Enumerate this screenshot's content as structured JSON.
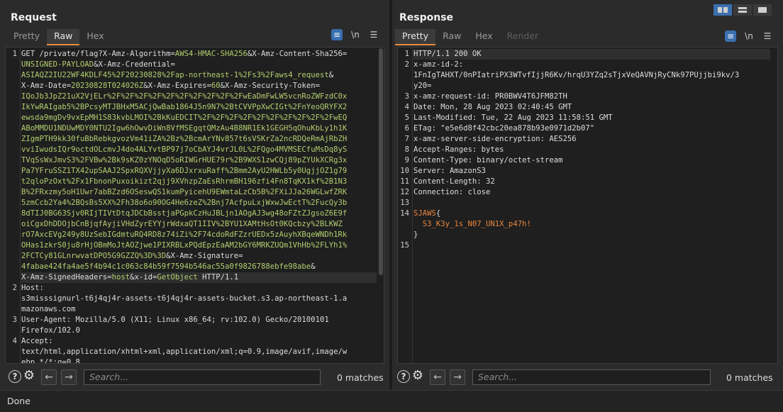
{
  "request": {
    "title": "Request",
    "tabs": [
      {
        "label": "Pretty",
        "active": false
      },
      {
        "label": "Raw",
        "active": true
      },
      {
        "label": "Hex",
        "active": false
      }
    ],
    "tools": {
      "wrap": "≡",
      "newline": "\\n",
      "menu": "☰"
    },
    "lines": [
      {
        "num": "1",
        "parts": [
          [
            "k",
            "GET /private/flag?X-Amz-Algorithm="
          ],
          [
            "v",
            "AWS4-HMAC-SHA256"
          ],
          [
            "k",
            "&X-Amz-Content-Sha256="
          ]
        ]
      },
      {
        "num": "",
        "parts": [
          [
            "v",
            "UNSIGNED-PAYLOAD"
          ],
          [
            "k",
            "&X-Amz-Credential="
          ]
        ]
      },
      {
        "num": "",
        "parts": [
          [
            "v",
            "ASIAQZ2IU22WF4KDLF45%2F20230828%2Fap-northeast-1%2Fs3%2Faws4_request"
          ],
          [
            "k",
            "&"
          ]
        ]
      },
      {
        "num": "",
        "parts": [
          [
            "k",
            "X-Amz-Date="
          ],
          [
            "v",
            "20230828T024026Z"
          ],
          [
            "k",
            "&X-Amz-Expires="
          ],
          [
            "v",
            "60"
          ],
          [
            "k",
            "&X-Amz-Security-Token="
          ]
        ]
      },
      {
        "num": "",
        "parts": [
          [
            "v",
            "IQoJb3JpZ21uX2VjELr%2F%2F%2F%2F%2F%2F%2F%2F%2F%2FwEaDmFwLW5vcnRoZWFzdC0x"
          ]
        ]
      },
      {
        "num": "",
        "parts": [
          [
            "v",
            "IkYwRAIgab5%2BPcsyMTJBHxM5ACjQwBab1864J5n9N7%2BtCVVPpXwCIGt%2FnYeoQRYFX2"
          ]
        ]
      },
      {
        "num": "",
        "parts": [
          [
            "v",
            "ewsda9mgDv9vxEpMH1S83kvbLMOI%2BkKuEDCIT%2F%2F%2F%2F%2F%2F%2F%2F%2F%2FwEQ"
          ]
        ]
      },
      {
        "num": "",
        "parts": [
          [
            "v",
            "ABoMMDU1NDUwMDY0NTU2Igw6hOwvDiWn8VfMSEgqtQMzAu4B8NR1Ek1GEGH5qOhuKbLy1h1K"
          ]
        ]
      },
      {
        "num": "",
        "parts": [
          [
            "v",
            "ZIgmPTH9kk30fuBbRebkgvozVm41iZA%2Bz%2BcmArYNv857t6sVSKrZa2ncRDQeRmAjRbZH"
          ]
        ]
      },
      {
        "num": "",
        "parts": [
          [
            "v",
            "vviIwudsIQr9octdOLcmvJ4do4ALYvtBP97j7oCbAYJ4vrJL0L%2FQgo4MVMSECfuMsDq8yS"
          ]
        ]
      },
      {
        "num": "",
        "parts": [
          [
            "v",
            "TVqSsWxJmvS3%2FVBw%2Bk9sKZ0zYNOqD5oRIWGrHUE79r%2B9WXS1zwCQj89pZYUkXCRg3x"
          ]
        ]
      },
      {
        "num": "",
        "parts": [
          [
            "v",
            "Pa7YFruSSZ1TX42upSAAJ2SpxRQXVjjyXa6DJxrxuRaff%2Bmm2AyU2HWLb5y0UgjjOZ1g79"
          ]
        ]
      },
      {
        "num": "",
        "parts": [
          [
            "v",
            "t2qloPzOxt%2Fx1FbnonPuxoikizt2qjj9XVhzpZaEsRhrmBH196zfi4Fn8TqKX1kf%2B1N3"
          ]
        ]
      },
      {
        "num": "",
        "parts": [
          [
            "v",
            "B%2FRxzmy5oH1Uwr7abBZzd6OSeswQS1kumPyicehU9EWmtaLzCb5B%2FXiJJa26WGLwfZRK"
          ]
        ]
      },
      {
        "num": "",
        "parts": [
          [
            "v",
            "5zmCcb2Ya4%2BQsBs5XX%2Fh38o6o90OG4He6zeZ%2Bnj7AcfpuLxjWxwJwEctT%2FucQy3b"
          ]
        ]
      },
      {
        "num": "",
        "parts": [
          [
            "v",
            "8dTIJ0BG63Sjv0RIjTIVtDtqJDCbBsstjaPGpkCzHuJBLjn1AOgAJ3wg48oFZtZJgsoZ6E9f"
          ]
        ]
      },
      {
        "num": "",
        "parts": [
          [
            "v",
            "oiCgxDhDDOjbCnBjqfAyjiVHdZyrEYYjrWdxaQT1IIV%2BYU1XAMtHsOt0KQcbzy%2BLKWZ"
          ]
        ]
      },
      {
        "num": "",
        "parts": [
          [
            "v",
            "rO7AxcEVg249y8UzSebIGdmtuRQ4RD8z74iZi%2F74cdoRdFZzrUEDx5zAuyhXBqeWNDh1Rk"
          ]
        ]
      },
      {
        "num": "",
        "parts": [
          [
            "v",
            "OHas1zkrS0ju8rHjOBmMoJtAOZjwe1PIXRBLxPQdEpzEaAM2bGY6MRKZUQm1VhHb%2FLYh1%"
          ]
        ]
      },
      {
        "num": "",
        "parts": [
          [
            "v",
            "2FCTCy81GLnrwvatDPO5G9GZZQ%3D%3D"
          ],
          [
            "k",
            "&X-Amz-Signature="
          ]
        ]
      },
      {
        "num": "",
        "parts": [
          [
            "v",
            "4fabae424fa4ae5f4b94c1c063c84b59f7594b546ac55a0f9826788ebfe98abe"
          ],
          [
            "k",
            "&"
          ]
        ]
      },
      {
        "num": "",
        "parts": [
          [
            "k",
            "X-Amz-SignedHeaders="
          ],
          [
            "v",
            "host"
          ],
          [
            "k",
            "&x-id="
          ],
          [
            "v",
            "GetObject"
          ],
          [
            "k",
            " HTTP/1.1"
          ]
        ],
        "highlight": true
      },
      {
        "num": "2",
        "parts": [
          [
            "k",
            "Host:"
          ]
        ]
      },
      {
        "num": "",
        "parts": [
          [
            "k",
            "s3misssignurl-t6j4qj4r-assets-t6j4qj4r-assets-bucket.s3.ap-northeast-1.a"
          ]
        ]
      },
      {
        "num": "",
        "parts": [
          [
            "k",
            "mazonaws.com"
          ]
        ]
      },
      {
        "num": "3",
        "parts": [
          [
            "k",
            "User-Agent: Mozilla/5.0 (X11; Linux x86_64; rv:102.0) Gecko/20100101"
          ]
        ]
      },
      {
        "num": "",
        "parts": [
          [
            "k",
            "Firefox/102.0"
          ]
        ]
      },
      {
        "num": "4",
        "parts": [
          [
            "k",
            "Accept:"
          ]
        ]
      },
      {
        "num": "",
        "parts": [
          [
            "k",
            "text/html,application/xhtml+xml,application/xml;q=0.9,image/avif,image/w"
          ]
        ]
      },
      {
        "num": "",
        "parts": [
          [
            "k",
            "ebp,*/*;q=0.8"
          ]
        ]
      }
    ],
    "search_placeholder": "Search...",
    "matches": "0 matches"
  },
  "response": {
    "title": "Response",
    "tabs": [
      {
        "label": "Pretty",
        "active": true
      },
      {
        "label": "Raw",
        "active": false
      },
      {
        "label": "Hex",
        "active": false
      },
      {
        "label": "Render",
        "active": false,
        "disabled": true
      }
    ],
    "tools": {
      "wrap": "≡",
      "newline": "\\n",
      "menu": "☰"
    },
    "lines": [
      {
        "num": "1",
        "parts": [
          [
            "k",
            "HTTP/1.1 200 OK"
          ]
        ],
        "highlight": true
      },
      {
        "num": "2",
        "parts": [
          [
            "k",
            "x-amz-id-2:"
          ]
        ]
      },
      {
        "num": "",
        "parts": [
          [
            "k",
            "1FnIgTAHXT/0nPIatriPX3WTvfIjjR6Kv/hrqU3YZq2sTjxVeQAVNjRyCNk97PUjjbi9kv/3"
          ]
        ]
      },
      {
        "num": "",
        "parts": [
          [
            "k",
            "y20="
          ]
        ]
      },
      {
        "num": "3",
        "parts": [
          [
            "k",
            "x-amz-request-id: PR0BWV4T6JFM82TH"
          ]
        ]
      },
      {
        "num": "4",
        "parts": [
          [
            "k",
            "Date: Mon, 28 Aug 2023 02:40:45 GMT"
          ]
        ]
      },
      {
        "num": "5",
        "parts": [
          [
            "k",
            "Last-Modified: Tue, 22 Aug 2023 11:58:51 GMT"
          ]
        ]
      },
      {
        "num": "6",
        "parts": [
          [
            "k",
            "ETag: \"e5e6d8f42cbc20ea878b93e0971d2b07\""
          ]
        ]
      },
      {
        "num": "7",
        "parts": [
          [
            "k",
            "x-amz-server-side-encryption: AES256"
          ]
        ]
      },
      {
        "num": "8",
        "parts": [
          [
            "k",
            "Accept-Ranges: bytes"
          ]
        ]
      },
      {
        "num": "9",
        "parts": [
          [
            "k",
            "Content-Type: binary/octet-stream"
          ]
        ]
      },
      {
        "num": "10",
        "parts": [
          [
            "k",
            "Server: AmazonS3"
          ]
        ]
      },
      {
        "num": "11",
        "parts": [
          [
            "k",
            "Content-Length: 32"
          ]
        ]
      },
      {
        "num": "12",
        "parts": [
          [
            "k",
            "Connection: close"
          ]
        ]
      },
      {
        "num": "13",
        "parts": [
          [
            "k",
            ""
          ]
        ]
      },
      {
        "num": "14",
        "parts": [
          [
            "o",
            "SJAWS"
          ],
          [
            "k",
            "{"
          ]
        ]
      },
      {
        "num": "",
        "parts": [
          [
            "o",
            "  S3_K3y_1s_N07_UN1X_p47h!"
          ]
        ]
      },
      {
        "num": "",
        "parts": [
          [
            "k",
            "}"
          ]
        ]
      },
      {
        "num": "15",
        "parts": [
          [
            "k",
            ""
          ]
        ]
      }
    ],
    "search_placeholder": "Search...",
    "matches": "0 matches"
  },
  "status": "Done"
}
